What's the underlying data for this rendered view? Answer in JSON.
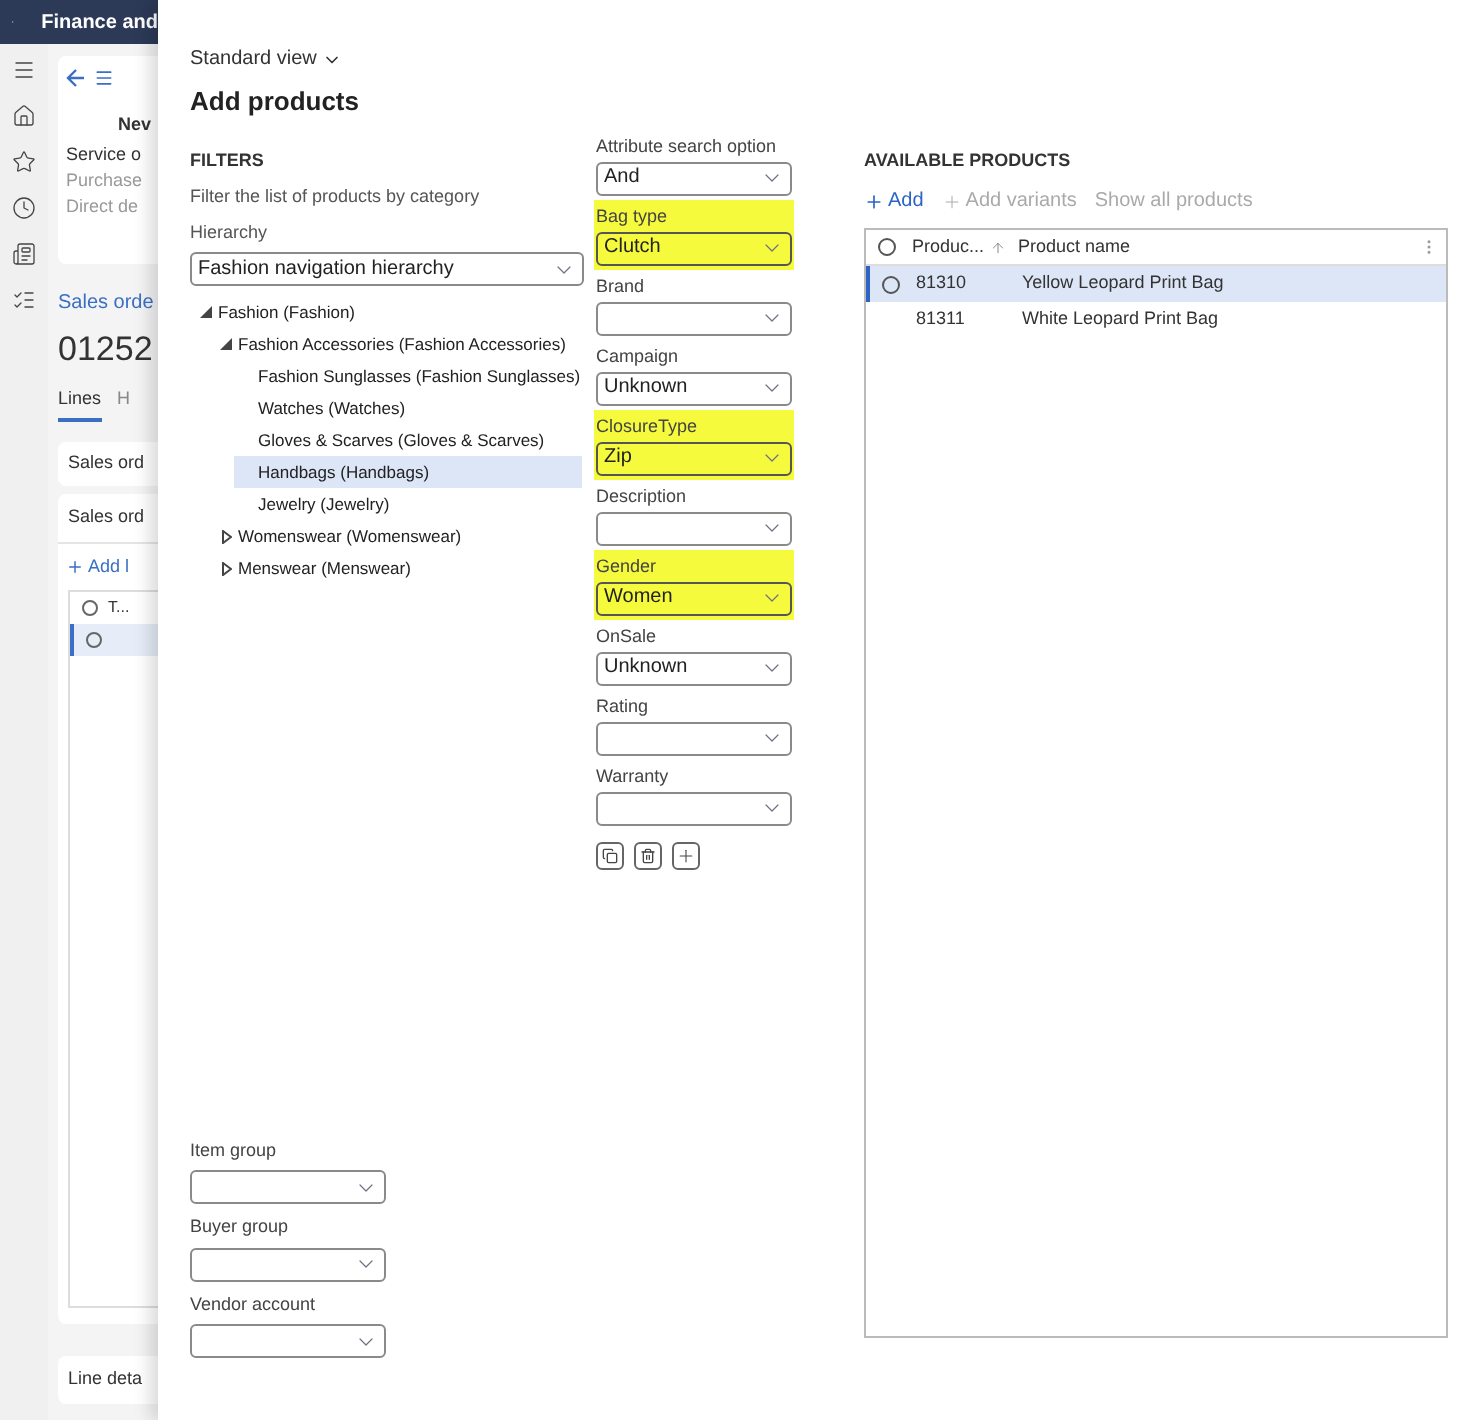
{
  "background_app": {
    "app_title": "Finance and",
    "card": {
      "heading": "Nev",
      "lines": [
        {
          "text": "Service o",
          "disabled": false
        },
        {
          "text": "Purchase",
          "disabled": true
        },
        {
          "text": "Direct de",
          "disabled": true
        }
      ]
    },
    "breadcrumb": "Sales orde",
    "order_number": "01252",
    "tabs": [
      {
        "label": "Lines",
        "selected": true
      },
      {
        "label": "H",
        "selected": false
      }
    ],
    "sections": [
      "Sales ord",
      "Sales ord"
    ],
    "add_button": "Add l",
    "grid_header": "T...",
    "grid_rows": [
      {
        "selected": true
      }
    ],
    "footer_section": "Line deta"
  },
  "dialog": {
    "view_selector": "Standard view",
    "title": "Add products",
    "filters": {
      "heading": "FILTERS",
      "description": "Filter the list of products by category",
      "hierarchy_label": "Hierarchy",
      "hierarchy_value": "Fashion navigation hierarchy",
      "tree": [
        {
          "label": "Fashion (Fashion)",
          "expanded": true,
          "selected": false,
          "children": [
            {
              "label": "Fashion Accessories (Fashion Accessories)",
              "expanded": true,
              "selected": false,
              "children": [
                {
                  "label": "Fashion Sunglasses (Fashion Sunglasses)",
                  "selected": false
                },
                {
                  "label": "Watches (Watches)",
                  "selected": false
                },
                {
                  "label": "Gloves & Scarves (Gloves & Scarves)",
                  "selected": false
                },
                {
                  "label": "Handbags (Handbags)",
                  "selected": true
                },
                {
                  "label": "Jewelry (Jewelry)",
                  "selected": false
                }
              ]
            },
            {
              "label": "Womenswear (Womenswear)",
              "expanded": false,
              "selected": false
            },
            {
              "label": "Menswear (Menswear)",
              "expanded": false,
              "selected": false
            }
          ]
        }
      ],
      "bottom_fields": [
        {
          "label": "Item group"
        },
        {
          "label": "Buyer group"
        },
        {
          "label": "Vendor account"
        }
      ]
    },
    "attributes": [
      {
        "label": "Attribute search option",
        "value": "And",
        "highlighted": false
      },
      {
        "label": "Bag type",
        "value": "Clutch",
        "highlighted": true
      },
      {
        "label": "Brand",
        "highlighted": false
      },
      {
        "label": "Campaign",
        "value": "Unknown",
        "highlighted": false
      },
      {
        "label": "ClosureType",
        "value": "Zip",
        "highlighted": true
      },
      {
        "label": "Description",
        "highlighted": false
      },
      {
        "label": "Gender",
        "value": "Women",
        "highlighted": true
      },
      {
        "label": "OnSale",
        "value": "Unknown",
        "highlighted": false
      },
      {
        "label": "Rating",
        "highlighted": false
      },
      {
        "label": "Warranty",
        "highlighted": false
      }
    ],
    "available": {
      "heading": "AVAILABLE PRODUCTS",
      "actions": [
        {
          "label": "Add",
          "kind": "add",
          "disabled": false
        },
        {
          "label": "Add variants",
          "kind": "variants",
          "disabled": true
        },
        {
          "label": "Show all products",
          "kind": "plain",
          "disabled": true
        }
      ],
      "columns": [
        "Produc...",
        "Product name"
      ],
      "rows": [
        {
          "cells": [
            "81310",
            "Yellow Leopard Print Bag"
          ],
          "selected": true
        },
        {
          "cells": [
            "81311",
            "White Leopard Print Bag"
          ],
          "selected": false
        }
      ]
    }
  }
}
